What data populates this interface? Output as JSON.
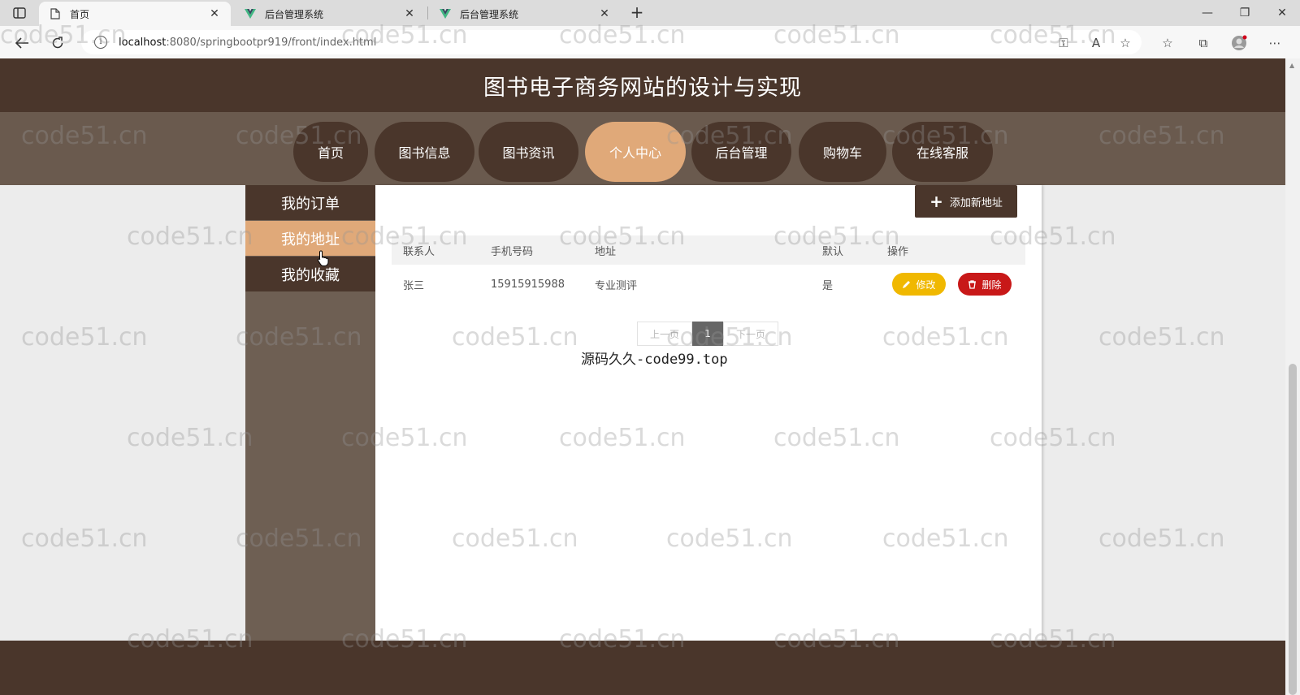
{
  "browser": {
    "tabs": [
      {
        "title": "首页",
        "icon": "page-icon"
      },
      {
        "title": "后台管理系统",
        "icon": "vue-logo-icon"
      },
      {
        "title": "后台管理系统",
        "icon": "vue-logo-icon"
      }
    ],
    "url_host": "localhost",
    "url_rest": ":8080/springbootpr919/front/index.html"
  },
  "site": {
    "title": "图书电子商务网站的设计与实现"
  },
  "nav": {
    "items": [
      "首页",
      "图书信息",
      "图书资讯",
      "个人中心",
      "后台管理",
      "购物车",
      "在线客服"
    ],
    "active": "个人中心"
  },
  "sidebar": {
    "items": [
      "我的订单",
      "我的地址",
      "我的收藏"
    ],
    "active": "我的地址"
  },
  "content": {
    "add_button": "添加新地址",
    "table": {
      "headers": [
        "联系人",
        "手机号码",
        "地址",
        "默认",
        "操作"
      ],
      "rows": [
        {
          "name": "张三",
          "phone": "15915915988",
          "address": "专业测评",
          "default": "是"
        }
      ],
      "edit_label": "修改",
      "delete_label": "删除"
    },
    "pager": {
      "prev": "上一页",
      "current": "1",
      "next": "下一页"
    },
    "overlay_text": "源码久久-code99.top"
  },
  "watermark": "code51.cn",
  "colors": {
    "brand_dark": "#4a362b",
    "brand_mid": "#6a5a4e",
    "accent": "#e0a979",
    "edit": "#f0b800",
    "delete": "#c81818"
  }
}
